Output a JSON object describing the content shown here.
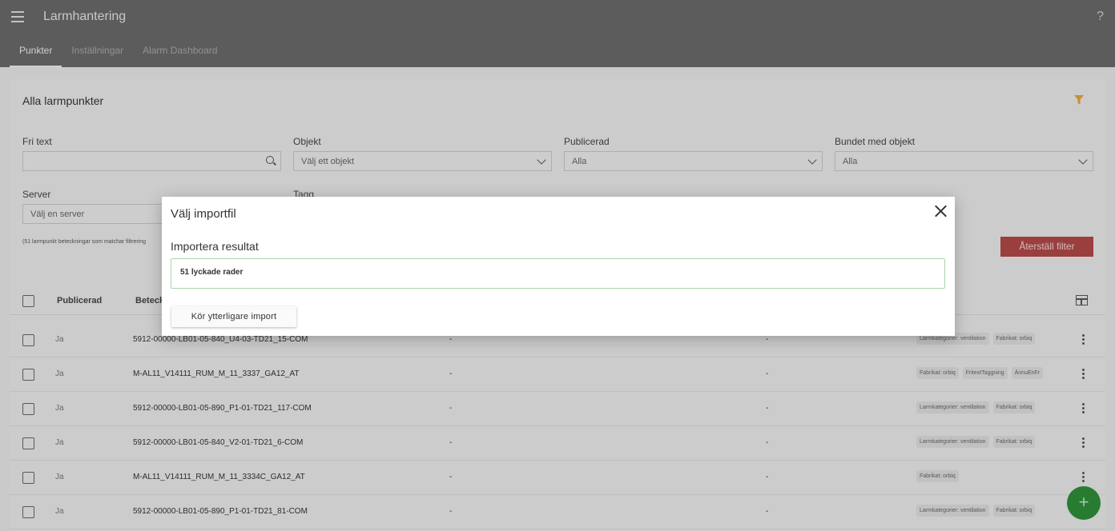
{
  "app": {
    "title": "Larmhantering",
    "help": "?"
  },
  "tabs": [
    {
      "label": "Punkter",
      "active": true
    },
    {
      "label": "Inställningar",
      "active": false
    },
    {
      "label": "Alarm Dashboard",
      "active": false
    }
  ],
  "card": {
    "title": "Alla larmpunkter"
  },
  "filters": {
    "fritext": {
      "label": "Fri text",
      "value": ""
    },
    "objekt": {
      "label": "Objekt",
      "placeholder": "Välj ett objekt"
    },
    "publicerad": {
      "label": "Publicerad",
      "value": "Alla"
    },
    "bundet": {
      "label": "Bundet med objekt",
      "value": "Alla"
    },
    "server": {
      "label": "Server",
      "placeholder": "Välj en server"
    },
    "tagg": {
      "label": "Tagg"
    }
  },
  "count_text": "(51 larmpunkt beteckningar som matchar filtrering",
  "reset_label": "Återställ filter",
  "table": {
    "headers": {
      "publicerad": "Publicerad",
      "beteckning": "Beteck"
    },
    "rows": [
      {
        "pub": "Ja",
        "name": "5912-00000-LB01-05-840_U4-03-TD21_15-COM",
        "d1": "-",
        "d2": "-",
        "tags": [
          "Larmkategorier: ventilation",
          "Fabrikat: orbiq"
        ]
      },
      {
        "pub": "Ja",
        "name": "M-AL11_V14111_RUM_M_11_3337_GA12_AT",
        "d1": "-",
        "d2": "-",
        "tags": [
          "Fabrikat: orbiq",
          "FritextTaggning",
          "ÄnnuEnFr"
        ]
      },
      {
        "pub": "Ja",
        "name": "5912-00000-LB01-05-890_P1-01-TD21_117-COM",
        "d1": "-",
        "d2": "-",
        "tags": [
          "Larmkategorier: ventilation",
          "Fabrikat: orbiq"
        ]
      },
      {
        "pub": "Ja",
        "name": "5912-00000-LB01-05-840_V2-01-TD21_6-COM",
        "d1": "-",
        "d2": "-",
        "tags": [
          "Larmkategorier: ventilation",
          "Fabrikat: orbiq"
        ]
      },
      {
        "pub": "Ja",
        "name": "M-AL11_V14111_RUM_M_11_3334C_GA12_AT",
        "d1": "-",
        "d2": "-",
        "tags": [
          "Fabrikat: orbiq"
        ]
      },
      {
        "pub": "Ja",
        "name": "5912-00000-LB01-05-890_P1-01-TD21_81-COM",
        "d1": "-",
        "d2": "-",
        "tags": [
          "Larmkategorier: ventilation",
          "Fabrikat: orbiq"
        ]
      }
    ]
  },
  "fab": {
    "label": "+"
  },
  "dialog": {
    "title": "Välj importfil",
    "result_title": "Importera resultat",
    "result_text": "51 lyckade rader",
    "run_button": "Kör ytterligare import"
  },
  "colors": {
    "appbar": "#6a6a6a",
    "accent_orange": "#e8a33a",
    "reset_red": "#b34848",
    "fab_green": "#2f8f3a",
    "success_border": "#a9d6a9"
  }
}
